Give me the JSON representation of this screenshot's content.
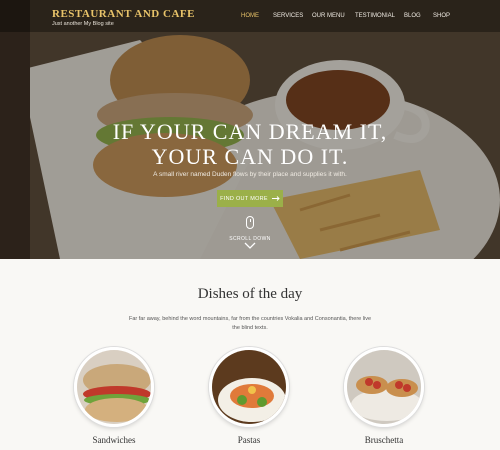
{
  "brand": {
    "title": "RESTAURANT AND CAFE",
    "tagline": "Just another My Blog site"
  },
  "nav": {
    "items": [
      {
        "label": "HOME",
        "active": true
      },
      {
        "label": "SERVICES",
        "active": false
      },
      {
        "label": "OUR MENU",
        "active": false
      },
      {
        "label": "TESTIMONIAL",
        "active": false
      },
      {
        "label": "BLOG",
        "active": false
      },
      {
        "label": "SHOP",
        "active": false
      }
    ]
  },
  "hero": {
    "title_line1": "IF YOUR CAN DREAM IT,",
    "title_line2": "YOUR CAN DO IT.",
    "subtitle": "A small river named Duden flows by their place and supplies it with.",
    "cta_label": "FIND OUT MORE",
    "scroll_label": "SCROLL DOWN"
  },
  "dishes": {
    "title": "Dishes of the day",
    "description": "Far far away, behind the word mountains, far from the countries Vokalia and Consonantia, there live the blind texts.",
    "items": [
      {
        "name": "Sandwiches"
      },
      {
        "name": "Pastas"
      },
      {
        "name": "Bruschetta"
      }
    ]
  },
  "colors": {
    "accent_gold": "#e9c46a",
    "cta_green": "#9bb049"
  }
}
